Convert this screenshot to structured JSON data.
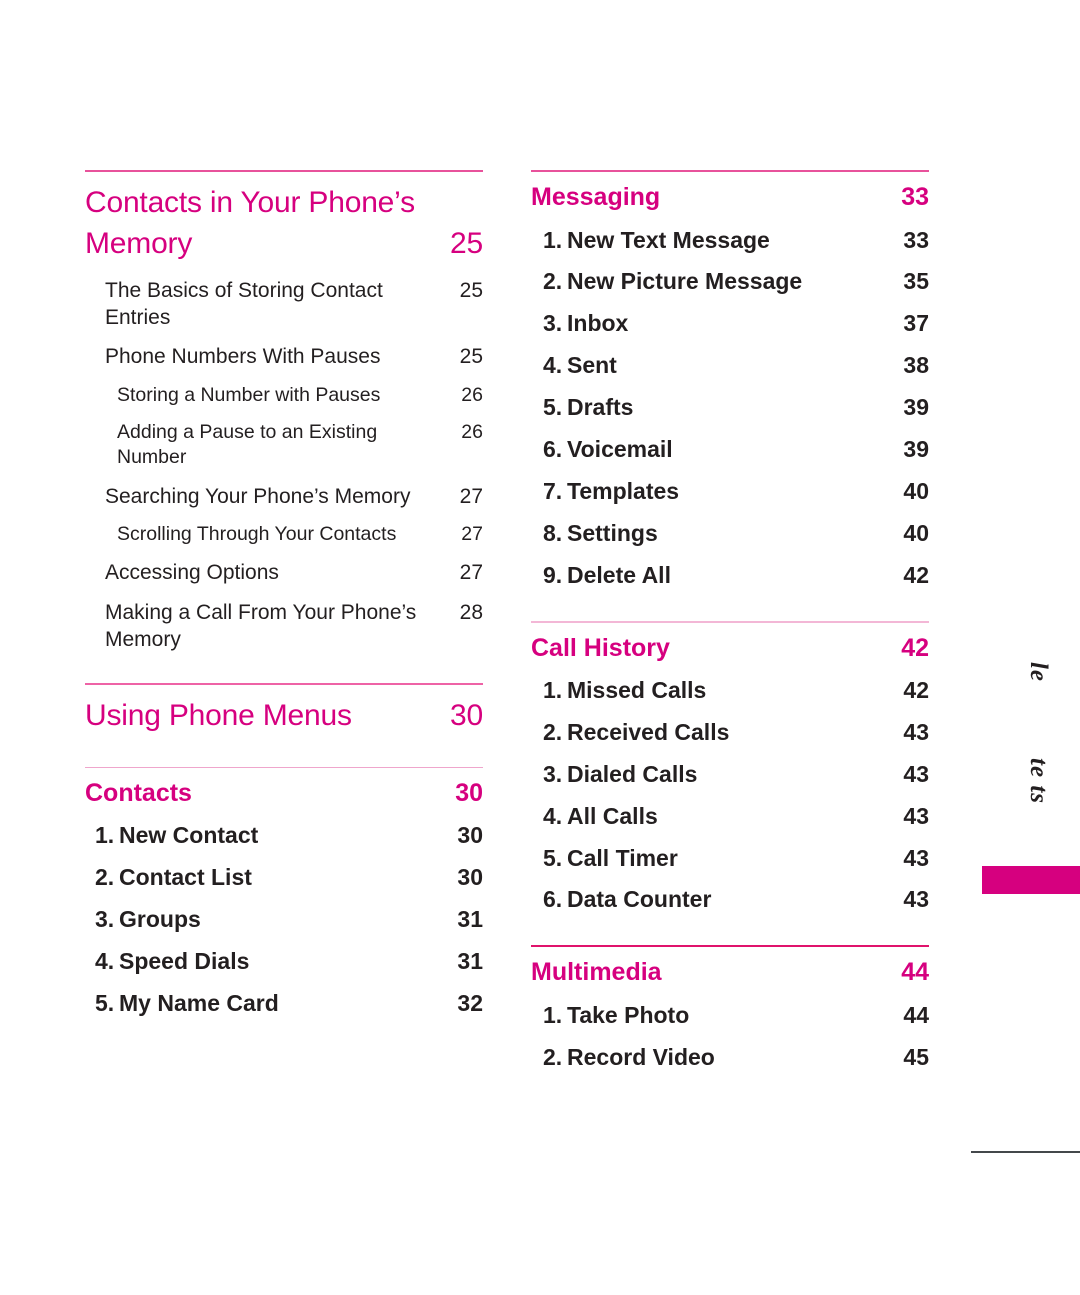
{
  "document": {
    "type": "table-of-contents",
    "accent_color": "#D6007F",
    "rule_color": "#E8529B",
    "text_color": "#231f20"
  },
  "left_column": {
    "blocks": [
      {
        "kind": "chapter",
        "rule": "strong",
        "title": "Contacts in Your Phone’s Memory",
        "page": "25",
        "wraps": true,
        "entries": [
          {
            "level": 1,
            "title": "The Basics of Storing Contact Entries",
            "page": "25"
          },
          {
            "level": 1,
            "title": "Phone Numbers With Pauses",
            "page": "25"
          },
          {
            "level": 2,
            "title": "Storing a Number with Pauses",
            "page": "26"
          },
          {
            "level": 2,
            "title": "Adding a Pause to an Existing Number",
            "page": "26"
          },
          {
            "level": 1,
            "title": "Searching Your Phone’s Memory",
            "page": "27"
          },
          {
            "level": 2,
            "title": "Scrolling Through Your Contacts",
            "page": "27"
          },
          {
            "level": 1,
            "title": "Accessing Options",
            "page": "27"
          },
          {
            "level": 1,
            "title": "Making a Call From Your Phone’s Memory",
            "page": "28"
          }
        ]
      },
      {
        "kind": "chapter",
        "rule": "medium",
        "title": "Using Phone Menus",
        "page": "30",
        "wraps": false,
        "entries": []
      },
      {
        "kind": "section",
        "rule": "light",
        "title": "Contacts",
        "page": "30",
        "entries": [
          {
            "num": "1.",
            "title": "New Contact",
            "page": "30"
          },
          {
            "num": "2.",
            "title": "Contact List",
            "page": "30"
          },
          {
            "num": "3.",
            "title": "Groups",
            "page": "31"
          },
          {
            "num": "4.",
            "title": "Speed Dials",
            "page": "31"
          },
          {
            "num": "5.",
            "title": "My Name Card",
            "page": "32"
          }
        ]
      }
    ]
  },
  "right_column": {
    "blocks": [
      {
        "kind": "section",
        "rule": "strong",
        "title": "Messaging",
        "page": "33",
        "entries": [
          {
            "num": "1.",
            "title": "New Text Message",
            "page": "33"
          },
          {
            "num": "2.",
            "title": "New Picture Message",
            "page": "35"
          },
          {
            "num": "3.",
            "title": "Inbox",
            "page": "37"
          },
          {
            "num": "4.",
            "title": "Sent",
            "page": "38"
          },
          {
            "num": "5.",
            "title": "Drafts",
            "page": "39"
          },
          {
            "num": "6.",
            "title": "Voicemail",
            "page": "39"
          },
          {
            "num": "7.",
            "title": "Templates",
            "page": "40"
          },
          {
            "num": "8.",
            "title": "Settings",
            "page": "40"
          },
          {
            "num": "9.",
            "title": "Delete All",
            "page": "42"
          }
        ]
      },
      {
        "kind": "section",
        "rule": "soft",
        "title": "Call History",
        "page": "42",
        "entries": [
          {
            "num": "1.",
            "title": "Missed Calls",
            "page": "42"
          },
          {
            "num": "2.",
            "title": "Received Calls",
            "page": "43"
          },
          {
            "num": "3.",
            "title": "Dialed Calls",
            "page": "43"
          },
          {
            "num": "4.",
            "title": "All Calls",
            "page": "43"
          },
          {
            "num": "5.",
            "title": "Call Timer",
            "page": "43"
          },
          {
            "num": "6.",
            "title": "Data Counter",
            "page": "43"
          }
        ]
      },
      {
        "kind": "section",
        "rule": "vivid",
        "title": "Multimedia",
        "page": "44",
        "entries": [
          {
            "num": "1.",
            "title": "Take Photo",
            "page": "44"
          },
          {
            "num": "2.",
            "title": "Record Video",
            "page": "45"
          }
        ]
      }
    ]
  },
  "thumb_tab": {
    "line_one": "le",
    "line_two": "te ts",
    "block_color": "#D6007F"
  }
}
